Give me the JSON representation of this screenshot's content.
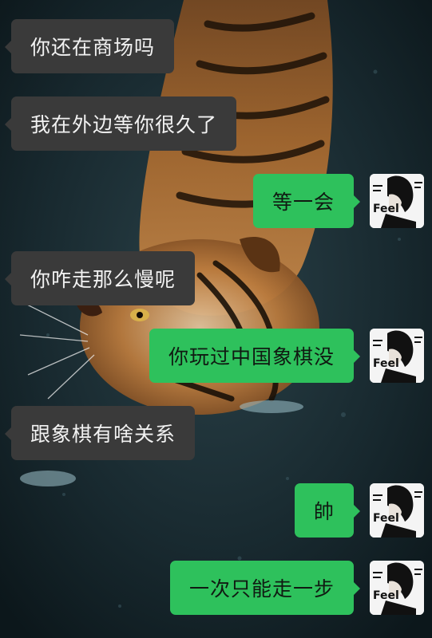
{
  "chat": {
    "messages": [
      {
        "side": "in",
        "text": "你还在商场吗"
      },
      {
        "side": "in",
        "text": "我在外边等你很久了"
      },
      {
        "side": "out",
        "text": "等一会"
      },
      {
        "side": "in",
        "text": "你咋走那么慢呢"
      },
      {
        "side": "out",
        "text": "你玩过中国象棋没"
      },
      {
        "side": "in",
        "text": "跟象棋有啥关系"
      },
      {
        "side": "out",
        "text": "帥"
      },
      {
        "side": "out",
        "text": "一次只能走一步"
      }
    ],
    "avatar_text": "Feel",
    "background": "tiger-swimming-wallpaper"
  },
  "colors": {
    "incoming_bubble": "#3a3a3a",
    "outgoing_bubble": "#2ec15c",
    "background": "#14262c"
  }
}
